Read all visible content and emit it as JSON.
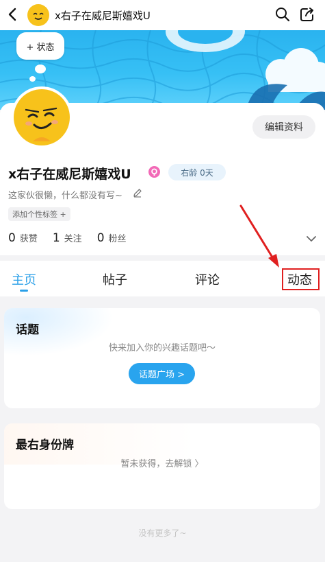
{
  "header": {
    "title": "x右子在威尼斯嬉戏U",
    "back_icon": "chevron-left-icon",
    "search_icon": "search-icon",
    "share_icon": "share-icon"
  },
  "banner": {
    "status_label": "+ 状态"
  },
  "profile": {
    "edit_label": "编辑资料",
    "name": "x右子在威尼斯嬉戏U",
    "age_badge": "右龄 0天",
    "bio": "这家伙很懒，什么都没有写~",
    "tag_label": "添加个性标签 +",
    "stats": [
      {
        "num": "0",
        "label": "获赞"
      },
      {
        "num": "1",
        "label": "关注"
      },
      {
        "num": "0",
        "label": "粉丝"
      }
    ]
  },
  "tabs": [
    {
      "label": "主页"
    },
    {
      "label": "帖子"
    },
    {
      "label": "评论"
    },
    {
      "label": "动态"
    }
  ],
  "topics_card": {
    "title": "话题",
    "subtitle": "快来加入你的兴趣话题吧〜",
    "button_label": "话题广场 >"
  },
  "badge_card": {
    "title": "最右身份牌",
    "subtitle": "暂未获得，去解锁 〉"
  },
  "footer": {
    "text": "没有更多了~"
  },
  "colors": {
    "accent": "#2ba0e8",
    "banner": "#37c0f5",
    "highlight": "#e02020",
    "avatar": "#f7c21b"
  }
}
